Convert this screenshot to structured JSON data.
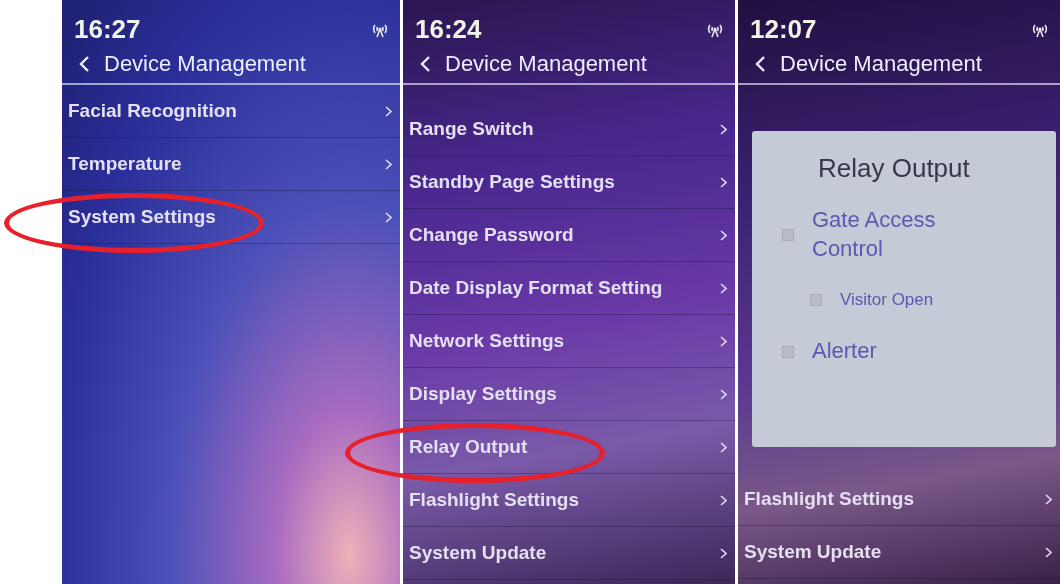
{
  "screens": [
    {
      "time": "16:27",
      "title": "Device Management",
      "items": [
        {
          "label": "Facial Recognition",
          "circled": false
        },
        {
          "label": "Temperature",
          "circled": false
        },
        {
          "label": "System Settings",
          "circled": true
        }
      ]
    },
    {
      "time": "16:24",
      "title": "Device Management",
      "items": [
        {
          "label": "Range Switch",
          "circled": false
        },
        {
          "label": "Standby Page Settings",
          "circled": false
        },
        {
          "label": "Change Password",
          "circled": false
        },
        {
          "label": "Date Display Format Setting",
          "circled": false
        },
        {
          "label": "Network Settings",
          "circled": false
        },
        {
          "label": "Display Settings",
          "circled": false
        },
        {
          "label": "Relay Output",
          "circled": true
        },
        {
          "label": "Flashlight Settings",
          "circled": false
        },
        {
          "label": "System Update",
          "circled": false
        }
      ]
    },
    {
      "time": "12:07",
      "title": "Device Management",
      "dialog": {
        "title": "Relay Output",
        "options": [
          {
            "label": "Gate Access Control",
            "checked": false,
            "children": [
              {
                "label": "Visitor Open",
                "checked": false
              }
            ]
          },
          {
            "label": "Alerter",
            "checked": false
          }
        ]
      },
      "items": [
        {
          "label": "Flashlight Settings",
          "circled": false
        },
        {
          "label": "System Update",
          "circled": false
        }
      ]
    }
  ]
}
